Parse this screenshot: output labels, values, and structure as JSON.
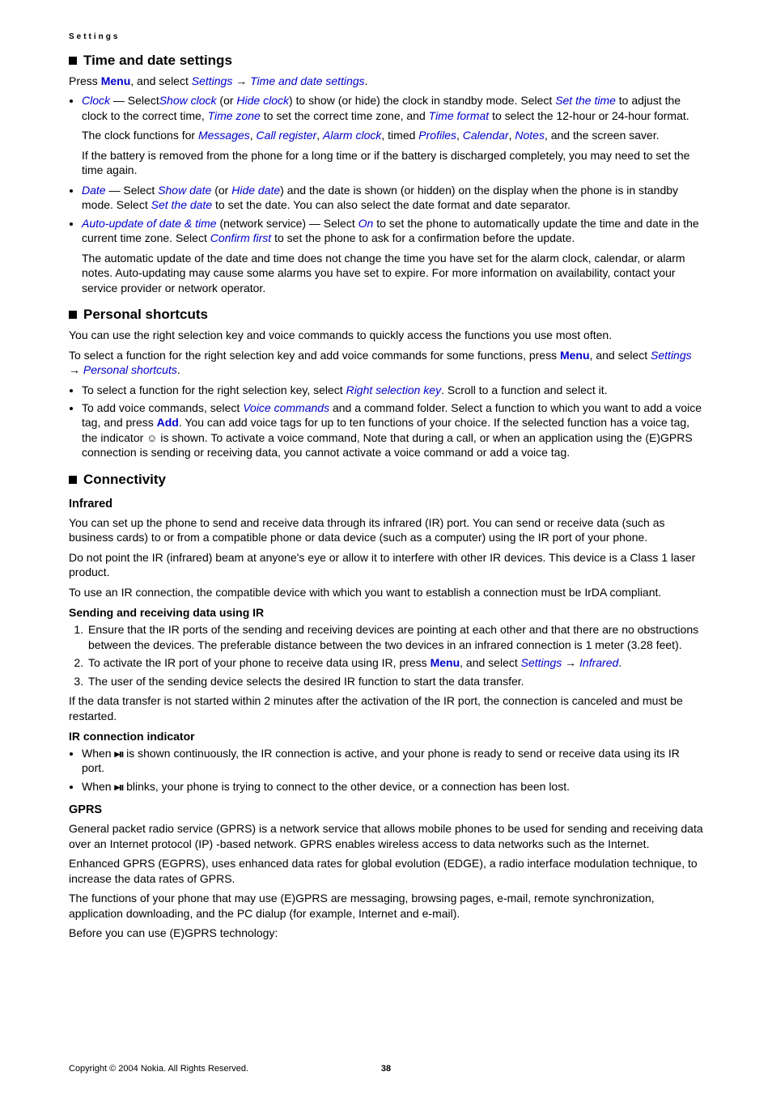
{
  "header": "Settings",
  "sections": {
    "time_date": {
      "title": "Time and date settings",
      "intro_pre": "Press ",
      "intro_menu": "Menu",
      "intro_mid": ", and select ",
      "intro_s1": "Settings",
      "intro_arrow": " → ",
      "intro_s2": "Time and date settings",
      "intro_end": ".",
      "clock_label": "Clock",
      "clock_text": " — Select",
      "show_clock": "Show clock",
      "clock_or": " (or ",
      "hide_clock": "Hide clock",
      "clock_after": ") to show (or hide) the clock in standby mode. Select ",
      "set_time": "Set the time",
      "clock_after2": " to adjust the clock to the correct time, ",
      "time_zone": "Time zone",
      "clock_after3": " to set the correct time zone, and ",
      "time_format": "Time format",
      "clock_after4": " to select the 12-hour or 24-hour format.",
      "clock_funcs_pre": "The clock functions for ",
      "cf1": "Messages",
      "cf2": "Call register",
      "cf3": "Alarm clock",
      "cf_timed": ", timed ",
      "cf4": "Profiles",
      "cf5": "Calendar",
      "cf6": "Notes",
      "cf_end": ", and the screen saver.",
      "battery": "If the battery is removed from the phone for a long time or if the battery is discharged completely, you may need to set the time again.",
      "date_label": "Date",
      "date_text": " — Select ",
      "show_date": "Show date",
      "date_or": " (or ",
      "hide_date": "Hide date",
      "date_after": ") and the date is shown (or hidden) on the display when the phone is in standby mode. Select ",
      "set_date": "Set the date",
      "date_after2": " to set the date. You can also select the date format and date separator.",
      "auto_label": "Auto-update of date & time",
      "auto_text": " (network service) — Select ",
      "auto_on": "On",
      "auto_after": " to set the phone to automatically update the time and date in the current time zone. Select ",
      "confirm": "Confirm first",
      "auto_after2": " to set the phone to ask for a confirmation before the update.",
      "auto_note": "The automatic update of the date and time does not change the time you have set for the alarm clock, calendar, or alarm notes. Auto-updating may cause some alarms you have set to expire. For more information on availability, contact your service provider or network operator."
    },
    "shortcuts": {
      "title": "Personal shortcuts",
      "p1": "You can use the right selection key and voice commands to quickly access the functions you use most often.",
      "p2_pre": "To select a function for the right selection key and add voice commands for some functions, press ",
      "p2_menu": "Menu",
      "p2_mid": ", and select ",
      "p2_s1": "Settings",
      "p2_arrow": " → ",
      "p2_s2": "Personal shortcuts",
      "p2_end": ".",
      "li1_pre": "To select a function for the right selection key, select ",
      "li1_link": "Right selection key",
      "li1_end": ". Scroll to a function and select it.",
      "li2_pre": "To add voice commands, select ",
      "li2_link": "Voice commands",
      "li2_mid": " and a command folder. Select a function to which you want to add a voice tag, and press ",
      "li2_add": "Add",
      "li2_after": ". You can add voice tags for up to ten functions of your choice. If the selected function has a voice tag, the indicator ",
      "li2_after2": " is shown. To activate a voice command, Note that during a call, or when an application using the (E)GPRS connection is sending or receiving data, you cannot activate a voice command or add a voice tag."
    },
    "connectivity": {
      "title": "Connectivity",
      "infrared": {
        "title": "Infrared",
        "p1": "You can set up the phone to send and receive data through its infrared (IR) port. You can send or receive data (such as business cards) to or from a compatible phone or data device (such as a computer) using the IR port of your phone.",
        "p2": "Do not point the IR (infrared) beam at anyone's eye or allow it to interfere with other IR devices. This device is a Class 1 laser product.",
        "p3": "To use an IR connection, the compatible device with which you want to establish a connection must be IrDA compliant.",
        "send_title": "Sending and receiving data using IR",
        "ol1": "Ensure that the IR ports of the sending and receiving devices are pointing at each other and that there are no obstructions between the devices. The preferable distance between the two devices in an infrared connection is 1 meter (3.28 feet).",
        "ol2_pre": "To activate the IR port of your phone to receive data using IR, press ",
        "ol2_menu": "Menu",
        "ol2_mid": ", and select ",
        "ol2_s1": "Settings",
        "ol2_arrow": " → ",
        "ol2_s2": "Infrared",
        "ol2_end": ".",
        "ol3": "The user of the sending device selects the desired IR function to start the data transfer.",
        "after_ol": "If the data transfer is not started within 2 minutes after the activation of the IR port, the connection is canceled and must be restarted.",
        "ind_title": "IR connection indicator",
        "ind1_pre": "When ",
        "ind1_post": " is shown continuously, the IR connection is active, and your phone is ready to send or receive data using its IR port.",
        "ind2_pre": "When ",
        "ind2_post": " blinks, your phone is trying to connect to the other device, or a connection has been lost."
      },
      "gprs": {
        "title": "GPRS",
        "p1": "General packet radio service (GPRS) is a network service that allows mobile phones to be used for sending and receiving data over an Internet protocol (IP) -based network. GPRS enables wireless access to data networks such as the Internet.",
        "p2": "Enhanced GPRS (EGPRS), uses enhanced data rates for global evolution (EDGE), a radio interface modulation technique, to increase the data rates of GPRS.",
        "p3": "The functions of your phone that may use (E)GPRS are messaging, browsing pages, e-mail, remote synchronization, application downloading, and the PC dialup (for example, Internet and e-mail).",
        "p4": "Before you can use (E)GPRS technology:"
      }
    }
  },
  "footer": {
    "copyright": "Copyright © 2004 Nokia. All Rights Reserved.",
    "page": "38"
  },
  "icons": {
    "ir": "▸ıı",
    "voice": "☺"
  }
}
